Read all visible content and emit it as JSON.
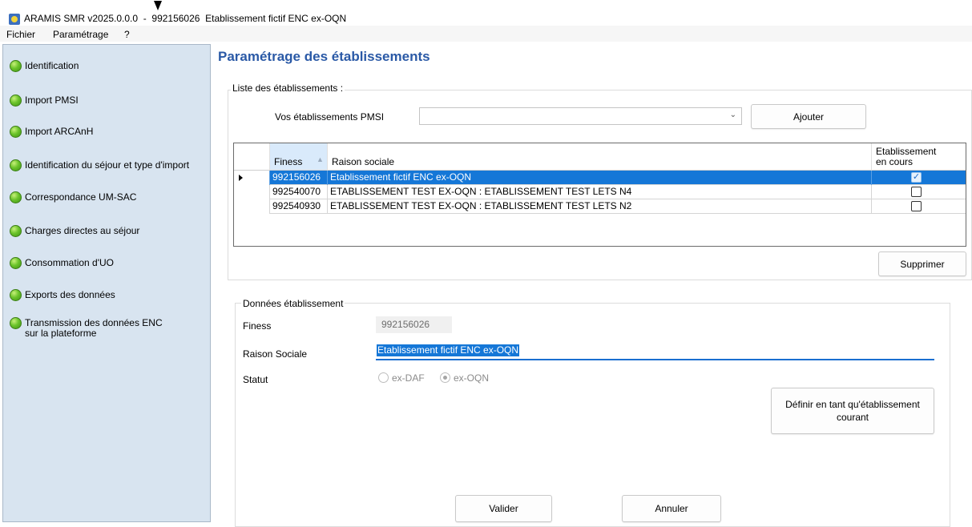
{
  "window": {
    "title": "ARAMIS SMR v2025.0.0.0  -  992156026  Etablissement fictif ENC ex-OQN"
  },
  "menu": [
    {
      "label": "Fichier"
    },
    {
      "label": "Paramétrage"
    },
    {
      "label": "?"
    }
  ],
  "sidebar": {
    "items": [
      {
        "label": "Identification"
      },
      {
        "label": "Import PMSI"
      },
      {
        "label": "Import ARCAnH"
      },
      {
        "label": "Identification du séjour et type d'import"
      },
      {
        "label": "Correspondance UM-SAC"
      },
      {
        "label": "Charges directes au séjour"
      },
      {
        "label": "Consommation d'UO"
      },
      {
        "label": "Exports des données"
      },
      {
        "label": "Transmission des données ENC",
        "label2": "sur la plateforme"
      }
    ]
  },
  "main": {
    "title": "Paramétrage des établissements",
    "list_group": {
      "legend": "Liste des établissements :",
      "pmsi_label": "Vos établissements PMSI",
      "combo_value": "",
      "add_button": "Ajouter",
      "delete_button": "Supprimer",
      "grid": {
        "columns": {
          "finess": "Finess",
          "raison": "Raison sociale",
          "current_line1": "Etablissement",
          "current_line2": "en cours"
        },
        "rows": [
          {
            "finess": "992156026",
            "raison": "Etablissement fictif ENC ex-OQN",
            "current": true,
            "selected": true
          },
          {
            "finess": "992540070",
            "raison": "ETABLISSEMENT TEST EX-OQN : ETABLISSEMENT TEST LETS N4",
            "current": false,
            "selected": false
          },
          {
            "finess": "992540930",
            "raison": "ETABLISSEMENT TEST EX-OQN : ETABLISSEMENT TEST LETS N2",
            "current": false,
            "selected": false
          }
        ]
      }
    },
    "details_group": {
      "legend": "Données établissement",
      "finess_label": "Finess",
      "finess_value": "992156026",
      "raison_label": "Raison Sociale",
      "raison_value": "Etablissement fictif ENC ex-OQN",
      "statut_label": "Statut",
      "statut_options": [
        {
          "label": "ex-DAF",
          "checked": false
        },
        {
          "label": "ex-OQN",
          "checked": true
        }
      ],
      "set_current_line1": "Définir en tant qu'établissement",
      "set_current_line2": "courant"
    },
    "validate_button": "Valider",
    "cancel_button": "Annuler"
  },
  "colors": {
    "title_blue": "#2a59a6",
    "selection_blue": "#1577d7",
    "sidebar_bg": "#d8e4f0",
    "status_green": "#6cc42b"
  },
  "icons": {
    "app": "aramis-app-icon",
    "status": "green-status-dot-icon",
    "combo": "chevron-down-icon",
    "sort": "sort-ascending-icon",
    "row": "row-pointer-icon"
  }
}
